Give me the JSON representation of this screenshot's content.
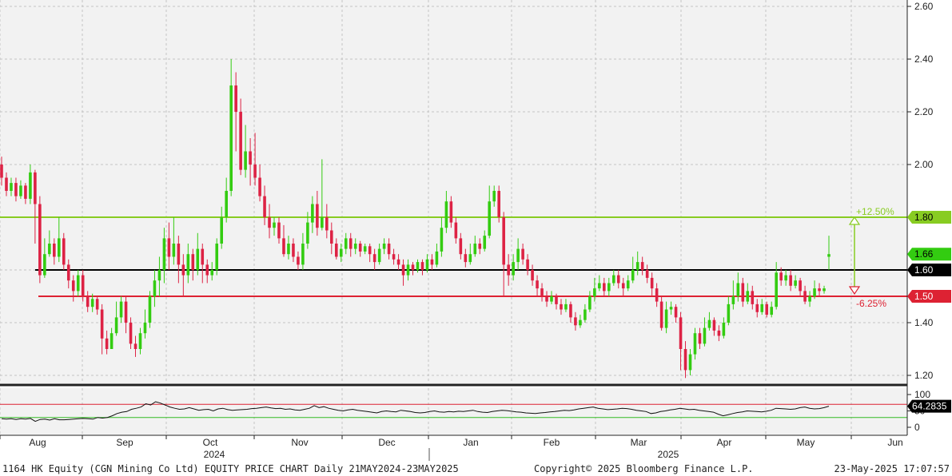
{
  "footer": {
    "left": "1164 HK Equity (CGN Mining Co Ltd) EQUITY PRICE CHART  Daily 21MAY2024-23MAY2025",
    "center": "Copyright© 2025 Bloomberg Finance L.P.",
    "right": "23-May-2025 17:07:57"
  },
  "colors": {
    "up": "#33cc11",
    "down": "#dd2244",
    "upper_line": "#88cc22",
    "lower_line": "#dd2233",
    "mid_line": "#000000"
  },
  "chart_data": [
    {
      "type": "candlestick",
      "x_months": [
        "Aug",
        "Sep",
        "Oct",
        "Nov",
        "Dec",
        "Jan",
        "Feb",
        "Mar",
        "Apr",
        "May",
        "Jun"
      ],
      "x_years": [
        "2024",
        "2025"
      ],
      "ylim": [
        1.17,
        2.62
      ],
      "y_ticks": [
        "2.60",
        "2.40",
        "2.20",
        "2.00",
        "1.80",
        "1.60",
        "1.40",
        "1.20"
      ],
      "grid": true,
      "last_price": "1.66",
      "levels": [
        {
          "value": 1.8,
          "label": "1.80",
          "pct_label": "+12.50%",
          "color": "#88cc22"
        },
        {
          "value": 1.6,
          "label": "1.60",
          "color": "#000000"
        },
        {
          "value": 1.5,
          "label": "1.50",
          "pct_label": "-6.25%",
          "color": "#dd2233"
        }
      ],
      "candles": [
        [
          2.0,
          1.95,
          2.03,
          1.92
        ],
        [
          1.95,
          1.9,
          1.97,
          1.88
        ],
        [
          1.9,
          1.93,
          1.95,
          1.88
        ],
        [
          1.93,
          1.88,
          1.95,
          1.86
        ],
        [
          1.88,
          1.92,
          1.94,
          1.87
        ],
        [
          1.92,
          1.87,
          1.93,
          1.85
        ],
        [
          1.87,
          1.97,
          2.0,
          1.85
        ],
        [
          1.97,
          1.85,
          1.98,
          1.7
        ],
        [
          1.85,
          1.58,
          1.88,
          1.55
        ],
        [
          1.58,
          1.66,
          1.72,
          1.57
        ],
        [
          1.66,
          1.7,
          1.75,
          1.65
        ],
        [
          1.7,
          1.65,
          1.72,
          1.62
        ],
        [
          1.65,
          1.72,
          1.8,
          1.63
        ],
        [
          1.72,
          1.62,
          1.74,
          1.6
        ],
        [
          1.62,
          1.56,
          1.64,
          1.53
        ],
        [
          1.56,
          1.52,
          1.58,
          1.48
        ],
        [
          1.52,
          1.58,
          1.6,
          1.5
        ],
        [
          1.58,
          1.5,
          1.6,
          1.48
        ],
        [
          1.5,
          1.46,
          1.52,
          1.44
        ],
        [
          1.46,
          1.49,
          1.51,
          1.44
        ],
        [
          1.49,
          1.45,
          1.5,
          1.43
        ],
        [
          1.45,
          1.34,
          1.47,
          1.28
        ],
        [
          1.34,
          1.3,
          1.37,
          1.28
        ],
        [
          1.3,
          1.36,
          1.38,
          1.3
        ],
        [
          1.36,
          1.42,
          1.48,
          1.35
        ],
        [
          1.42,
          1.48,
          1.5,
          1.4
        ],
        [
          1.48,
          1.4,
          1.5,
          1.36
        ],
        [
          1.4,
          1.32,
          1.42,
          1.3
        ],
        [
          1.32,
          1.3,
          1.35,
          1.27
        ],
        [
          1.3,
          1.36,
          1.38,
          1.28
        ],
        [
          1.36,
          1.4,
          1.45,
          1.34
        ],
        [
          1.4,
          1.5,
          1.52,
          1.38
        ],
        [
          1.5,
          1.56,
          1.6,
          1.46
        ],
        [
          1.56,
          1.6,
          1.65,
          1.5
        ],
        [
          1.6,
          1.72,
          1.76,
          1.55
        ],
        [
          1.72,
          1.65,
          1.78,
          1.6
        ],
        [
          1.65,
          1.7,
          1.8,
          1.62
        ],
        [
          1.7,
          1.62,
          1.73,
          1.55
        ],
        [
          1.62,
          1.58,
          1.66,
          1.5
        ],
        [
          1.58,
          1.66,
          1.7,
          1.55
        ],
        [
          1.66,
          1.6,
          1.68,
          1.56
        ],
        [
          1.6,
          1.68,
          1.74,
          1.58
        ],
        [
          1.68,
          1.62,
          1.7,
          1.55
        ],
        [
          1.62,
          1.58,
          1.64,
          1.55
        ],
        [
          1.58,
          1.6,
          1.63,
          1.56
        ],
        [
          1.6,
          1.7,
          1.72,
          1.58
        ],
        [
          1.7,
          1.8,
          1.84,
          1.68
        ],
        [
          1.8,
          1.9,
          1.95,
          1.78
        ],
        [
          1.9,
          2.3,
          2.4,
          1.88
        ],
        [
          2.3,
          2.2,
          2.35,
          2.05
        ],
        [
          2.2,
          1.98,
          2.25,
          1.96
        ],
        [
          1.98,
          2.05,
          2.15,
          1.95
        ],
        [
          2.05,
          2.0,
          2.1,
          1.92
        ],
        [
          2.0,
          1.95,
          2.12,
          1.92
        ],
        [
          1.95,
          1.88,
          2.0,
          1.86
        ],
        [
          1.88,
          1.8,
          1.92,
          1.77
        ],
        [
          1.8,
          1.76,
          1.85,
          1.72
        ],
        [
          1.76,
          1.78,
          1.8,
          1.73
        ],
        [
          1.78,
          1.72,
          1.8,
          1.7
        ],
        [
          1.72,
          1.66,
          1.77,
          1.65
        ],
        [
          1.66,
          1.7,
          1.73,
          1.64
        ],
        [
          1.7,
          1.65,
          1.72,
          1.63
        ],
        [
          1.65,
          1.62,
          1.67,
          1.6
        ],
        [
          1.62,
          1.7,
          1.74,
          1.6
        ],
        [
          1.7,
          1.78,
          1.82,
          1.68
        ],
        [
          1.78,
          1.85,
          1.88,
          1.74
        ],
        [
          1.85,
          1.76,
          1.9,
          1.73
        ],
        [
          1.76,
          1.8,
          2.02,
          1.75
        ],
        [
          1.8,
          1.75,
          1.85,
          1.72
        ],
        [
          1.75,
          1.7,
          1.78,
          1.66
        ],
        [
          1.7,
          1.65,
          1.72,
          1.64
        ],
        [
          1.65,
          1.68,
          1.7,
          1.63
        ],
        [
          1.68,
          1.72,
          1.74,
          1.66
        ],
        [
          1.72,
          1.68,
          1.74,
          1.65
        ],
        [
          1.68,
          1.7,
          1.72,
          1.66
        ],
        [
          1.7,
          1.67,
          1.71,
          1.65
        ],
        [
          1.67,
          1.69,
          1.7,
          1.66
        ],
        [
          1.69,
          1.66,
          1.7,
          1.63
        ],
        [
          1.66,
          1.63,
          1.68,
          1.6
        ],
        [
          1.63,
          1.68,
          1.7,
          1.62
        ],
        [
          1.68,
          1.7,
          1.72,
          1.66
        ],
        [
          1.7,
          1.66,
          1.72,
          1.64
        ],
        [
          1.66,
          1.64,
          1.68,
          1.62
        ],
        [
          1.64,
          1.62,
          1.66,
          1.6
        ],
        [
          1.62,
          1.58,
          1.64,
          1.54
        ],
        [
          1.58,
          1.62,
          1.64,
          1.56
        ],
        [
          1.62,
          1.6,
          1.63,
          1.58
        ],
        [
          1.6,
          1.63,
          1.64,
          1.59
        ],
        [
          1.63,
          1.6,
          1.64,
          1.58
        ],
        [
          1.6,
          1.64,
          1.66,
          1.59
        ],
        [
          1.64,
          1.62,
          1.66,
          1.6
        ],
        [
          1.62,
          1.67,
          1.7,
          1.61
        ],
        [
          1.67,
          1.76,
          1.8,
          1.65
        ],
        [
          1.76,
          1.86,
          1.9,
          1.74
        ],
        [
          1.86,
          1.78,
          1.88,
          1.76
        ],
        [
          1.78,
          1.72,
          1.8,
          1.7
        ],
        [
          1.72,
          1.66,
          1.74,
          1.64
        ],
        [
          1.66,
          1.63,
          1.68,
          1.61
        ],
        [
          1.63,
          1.66,
          1.7,
          1.62
        ],
        [
          1.66,
          1.7,
          1.73,
          1.65
        ],
        [
          1.7,
          1.68,
          1.72,
          1.66
        ],
        [
          1.68,
          1.73,
          1.75,
          1.67
        ],
        [
          1.73,
          1.86,
          1.92,
          1.72
        ],
        [
          1.86,
          1.9,
          1.92,
          1.84
        ],
        [
          1.9,
          1.8,
          1.92,
          1.78
        ],
        [
          1.8,
          1.62,
          1.82,
          1.5
        ],
        [
          1.62,
          1.58,
          1.66,
          1.54
        ],
        [
          1.58,
          1.63,
          1.66,
          1.56
        ],
        [
          1.63,
          1.68,
          1.72,
          1.6
        ],
        [
          1.68,
          1.64,
          1.7,
          1.62
        ],
        [
          1.64,
          1.6,
          1.66,
          1.58
        ],
        [
          1.6,
          1.56,
          1.62,
          1.54
        ],
        [
          1.56,
          1.53,
          1.58,
          1.5
        ],
        [
          1.53,
          1.5,
          1.55,
          1.48
        ],
        [
          1.5,
          1.48,
          1.52,
          1.46
        ],
        [
          1.48,
          1.5,
          1.52,
          1.47
        ],
        [
          1.5,
          1.47,
          1.51,
          1.45
        ],
        [
          1.47,
          1.45,
          1.49,
          1.43
        ],
        [
          1.45,
          1.47,
          1.49,
          1.44
        ],
        [
          1.47,
          1.42,
          1.48,
          1.4
        ],
        [
          1.42,
          1.39,
          1.44,
          1.37
        ],
        [
          1.39,
          1.41,
          1.43,
          1.38
        ],
        [
          1.41,
          1.45,
          1.47,
          1.4
        ],
        [
          1.45,
          1.5,
          1.52,
          1.44
        ],
        [
          1.5,
          1.53,
          1.57,
          1.48
        ],
        [
          1.53,
          1.55,
          1.58,
          1.52
        ],
        [
          1.55,
          1.52,
          1.57,
          1.5
        ],
        [
          1.52,
          1.55,
          1.57,
          1.5
        ],
        [
          1.55,
          1.58,
          1.6,
          1.54
        ],
        [
          1.58,
          1.55,
          1.6,
          1.53
        ],
        [
          1.55,
          1.53,
          1.57,
          1.5
        ],
        [
          1.53,
          1.56,
          1.58,
          1.52
        ],
        [
          1.56,
          1.6,
          1.65,
          1.55
        ],
        [
          1.6,
          1.63,
          1.67,
          1.58
        ],
        [
          1.63,
          1.6,
          1.65,
          1.58
        ],
        [
          1.6,
          1.57,
          1.62,
          1.55
        ],
        [
          1.57,
          1.53,
          1.59,
          1.5
        ],
        [
          1.53,
          1.48,
          1.55,
          1.46
        ],
        [
          1.48,
          1.38,
          1.5,
          1.37
        ],
        [
          1.38,
          1.45,
          1.48,
          1.36
        ],
        [
          1.45,
          1.46,
          1.48,
          1.43
        ],
        [
          1.46,
          1.42,
          1.47,
          1.4
        ],
        [
          1.42,
          1.3,
          1.44,
          1.22
        ],
        [
          1.3,
          1.22,
          1.33,
          1.19
        ],
        [
          1.22,
          1.28,
          1.3,
          1.2
        ],
        [
          1.28,
          1.36,
          1.38,
          1.26
        ],
        [
          1.36,
          1.32,
          1.38,
          1.3
        ],
        [
          1.32,
          1.38,
          1.42,
          1.31
        ],
        [
          1.38,
          1.41,
          1.44,
          1.37
        ],
        [
          1.41,
          1.37,
          1.42,
          1.35
        ],
        [
          1.37,
          1.35,
          1.39,
          1.33
        ],
        [
          1.35,
          1.4,
          1.42,
          1.34
        ],
        [
          1.4,
          1.47,
          1.5,
          1.39
        ],
        [
          1.47,
          1.5,
          1.56,
          1.45
        ],
        [
          1.5,
          1.55,
          1.59,
          1.48
        ],
        [
          1.55,
          1.48,
          1.57,
          1.46
        ],
        [
          1.48,
          1.52,
          1.55,
          1.47
        ],
        [
          1.52,
          1.47,
          1.54,
          1.45
        ],
        [
          1.47,
          1.44,
          1.49,
          1.42
        ],
        [
          1.44,
          1.47,
          1.49,
          1.43
        ],
        [
          1.47,
          1.43,
          1.48,
          1.42
        ],
        [
          1.43,
          1.46,
          1.48,
          1.42
        ],
        [
          1.46,
          1.59,
          1.63,
          1.45
        ],
        [
          1.59,
          1.56,
          1.61,
          1.54
        ],
        [
          1.56,
          1.58,
          1.6,
          1.54
        ],
        [
          1.58,
          1.54,
          1.6,
          1.52
        ],
        [
          1.54,
          1.56,
          1.58,
          1.53
        ],
        [
          1.56,
          1.52,
          1.57,
          1.5
        ],
        [
          1.52,
          1.48,
          1.54,
          1.47
        ],
        [
          1.48,
          1.5,
          1.52,
          1.46
        ],
        [
          1.5,
          1.53,
          1.56,
          1.49
        ],
        [
          1.53,
          1.52,
          1.55,
          1.5
        ],
        [
          1.52,
          1.53,
          1.54,
          1.51
        ],
        [
          1.65,
          1.66,
          1.73,
          1.6
        ]
      ]
    },
    {
      "type": "line",
      "y_ticks": [
        "100",
        "50",
        "0"
      ],
      "last_value": "64.2835",
      "upper_band": 70,
      "lower_band": 30,
      "values": [
        26,
        25,
        26,
        24,
        26,
        25,
        27,
        18,
        24,
        25,
        22,
        26,
        23,
        23,
        24,
        25,
        26,
        27,
        26,
        25,
        30,
        28,
        30,
        35,
        42,
        46,
        48,
        55,
        58,
        62,
        72,
        68,
        78,
        74,
        68,
        62,
        58,
        55,
        56,
        60,
        56,
        52,
        54,
        55,
        50,
        56,
        58,
        54,
        52,
        53,
        54,
        55,
        57,
        58,
        60,
        62,
        59,
        57,
        58,
        55,
        56,
        53,
        52,
        55,
        58,
        66,
        60,
        63,
        58,
        55,
        52,
        50,
        53,
        55,
        52,
        50,
        48,
        46,
        44,
        48,
        50,
        48,
        47,
        52,
        50,
        48,
        45,
        44,
        45,
        48,
        50,
        47,
        46,
        48,
        47,
        49,
        48,
        50,
        52,
        48,
        46,
        45,
        48,
        50,
        52,
        51,
        49,
        47,
        46,
        44,
        43,
        42,
        44,
        45,
        47,
        48,
        50,
        52,
        51,
        53,
        56,
        58,
        60,
        62,
        58,
        56,
        54,
        55,
        56,
        58,
        57,
        55,
        52,
        50,
        48,
        42,
        44,
        48,
        50,
        53,
        55,
        58,
        56,
        54,
        55,
        52,
        50,
        48,
        46,
        40,
        35,
        38,
        42,
        45,
        47,
        50,
        49,
        48,
        47,
        49,
        52,
        58,
        57,
        56,
        55,
        56,
        60,
        62,
        58,
        56,
        57,
        60,
        64.28
      ]
    }
  ]
}
